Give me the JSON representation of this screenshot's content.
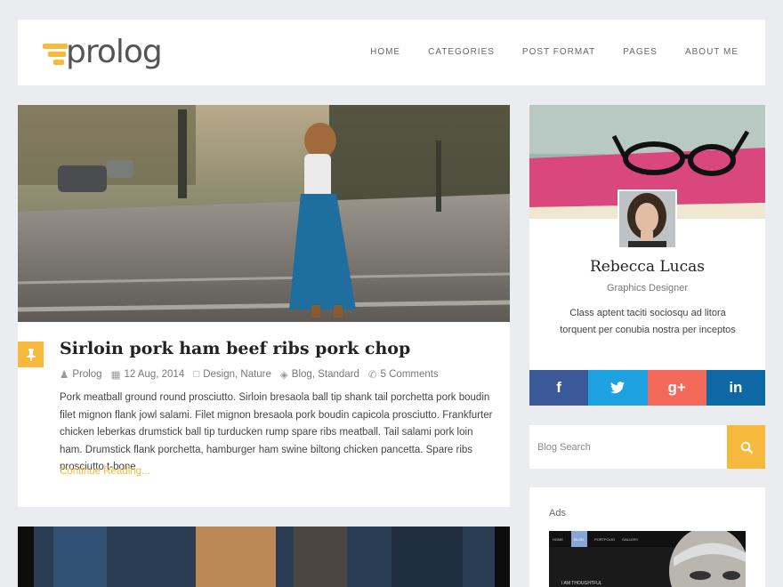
{
  "brand": {
    "name": "prolog"
  },
  "nav": {
    "items": [
      "HOME",
      "CATEGORIES",
      "POST FORMAT",
      "PAGES",
      "ABOUT ME"
    ]
  },
  "post": {
    "title": "Sirloin pork ham beef ribs pork chop",
    "author": "Prolog",
    "date": "12 Aug, 2014",
    "categories": [
      "Design",
      "Nature"
    ],
    "tags": [
      "Blog",
      "Standard"
    ],
    "comments": "5 Comments",
    "excerpt": "Pork meatball ground round prosciutto. Sirloin bresaola ball tip shank tail porchetta pork boudin filet mignon flank jowl salami. Filet mignon bresaola pork boudin capicola prosciutto. Frankfurter chicken leberkas drumstick ball tip turducken rump spare ribs meatball. Tail salami pork loin ham. Drumstick flank porchetta, hamburger ham swine biltong chicken pancetta. Spare ribs prosciutto t-bone",
    "read_more": "Continue Reading..."
  },
  "profile": {
    "name": "Rebecca Lucas",
    "role": "Graphics Designer",
    "bio": "Class aptent taciti sociosqu ad litora torquent per conubia nostra per inceptos",
    "social": [
      {
        "icon": "facebook-icon",
        "glyph": "f",
        "color": "#3b5998"
      },
      {
        "icon": "twitter-icon",
        "glyph": "t",
        "color": "#1da1e1"
      },
      {
        "icon": "google-plus-icon",
        "glyph": "g+",
        "color": "#f36a5a"
      },
      {
        "icon": "linkedin-icon",
        "glyph": "in",
        "color": "#0e68a6"
      }
    ]
  },
  "search": {
    "placeholder": "Blog Search"
  },
  "ads": {
    "title": "Ads",
    "banner_nav": [
      "HOME",
      "BLOG",
      "PORTFOLIO",
      "GALLERY"
    ],
    "banner_text": "I AM THOUGHTFUL"
  },
  "colors": {
    "accent": "#f6b93b"
  }
}
